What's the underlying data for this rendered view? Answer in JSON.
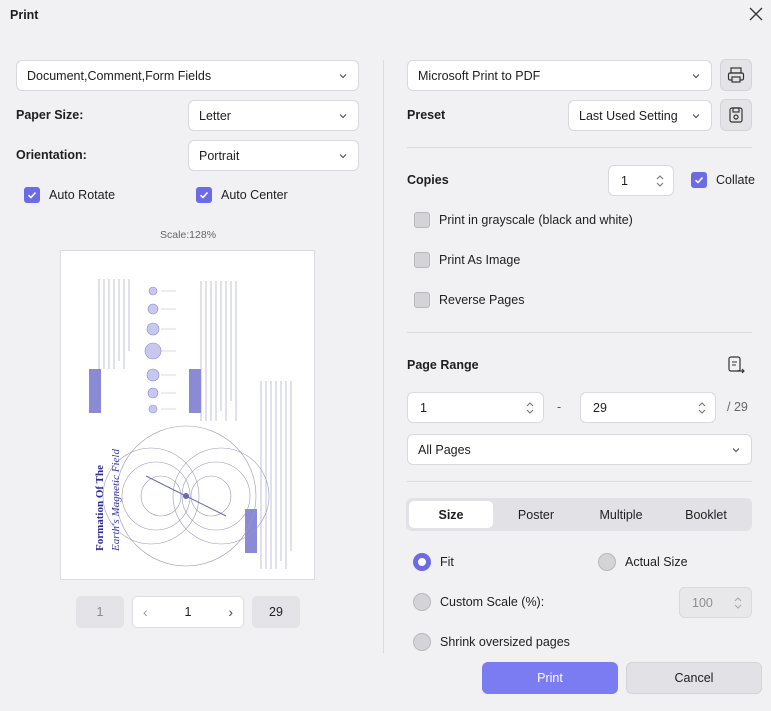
{
  "window": {
    "title": "Print"
  },
  "left": {
    "content_select": "Document,Comment,Form Fields",
    "paper_size": {
      "label": "Paper Size:",
      "value": "Letter"
    },
    "orientation": {
      "label": "Orientation:",
      "value": "Portrait"
    },
    "auto_rotate": {
      "label": "Auto Rotate",
      "checked": true
    },
    "auto_center": {
      "label": "Auto Center",
      "checked": true
    },
    "scale_label": "Scale:128%",
    "preview": {
      "title_line1": "Formation Of The",
      "title_line2": "Earth's Magnetic Field"
    },
    "pager": {
      "first": "1",
      "current": "1",
      "last": "29"
    }
  },
  "right": {
    "printer": "Microsoft Print to PDF",
    "preset": {
      "label": "Preset",
      "value": "Last Used Setting"
    },
    "copies": {
      "label": "Copies",
      "value": "1"
    },
    "collate": {
      "label": "Collate",
      "checked": true
    },
    "options": [
      {
        "label": "Print in grayscale (black and white)",
        "checked": false
      },
      {
        "label": "Print As Image",
        "checked": false
      },
      {
        "label": "Reverse Pages",
        "checked": false
      }
    ],
    "page_range": {
      "label": "Page Range",
      "from": "1",
      "dash": "-",
      "to": "29",
      "total": "/ 29",
      "mode": "All Pages"
    },
    "tabs": [
      "Size",
      "Poster",
      "Multiple",
      "Booklet"
    ],
    "active_tab": "Size",
    "sizing": {
      "fit": "Fit",
      "actual": "Actual Size",
      "custom": "Custom Scale (%):",
      "custom_value": "100",
      "shrink": "Shrink oversized pages",
      "selected": "Fit"
    }
  },
  "buttons": {
    "print": "Print",
    "cancel": "Cancel"
  },
  "colors": {
    "accent": "#6b6be6",
    "primary_button": "#7b7bf2",
    "background": "#f1f1f3"
  }
}
